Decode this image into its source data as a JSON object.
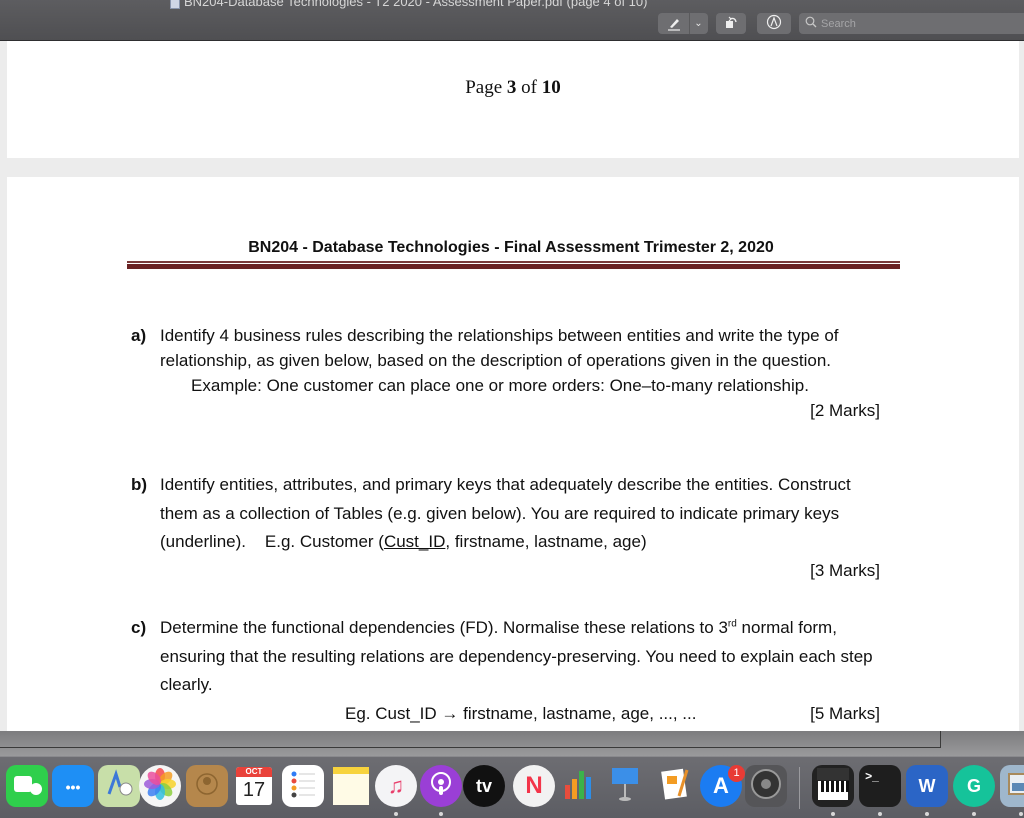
{
  "window": {
    "title": "BN204-Database Technologies - T2 2020 - Assessment Paper.pdf (page 4 of 10)"
  },
  "toolbar": {
    "markup_icon": "pen-icon",
    "markup_menu_icon": "chevron-down-icon",
    "rotate_icon": "rotate-icon",
    "annotate_icon": "markup-icon",
    "search_placeholder": "Search",
    "search_value": ""
  },
  "pages": {
    "previous_footer": {
      "prefix": "Page ",
      "current": "3",
      "middle": " of ",
      "total": "10"
    },
    "current": {
      "header": "BN204 - Database Technologies - Final Assessment Trimester 2, 2020",
      "questions": [
        {
          "label": "a)",
          "text": "Identify 4 business rules describing the relationships between entities and write the type of relationship, as given below, based on the description of operations given in the question.",
          "example": "Example:  One customer can place one or more orders: One–to-many relationship.",
          "marks": "[2 Marks]"
        },
        {
          "label": "b)",
          "text": "Identify entities, attributes, and primary keys that adequately describe the entities. Construct them as a collection of Tables (e.g. given below). You are required to indicate primary keys (underline).",
          "example_prefix": "E.g. Customer (",
          "example_key": "Cust_ID",
          "example_suffix": ", firstname, lastname, age)",
          "marks": "[3 Marks]"
        },
        {
          "label": "c)",
          "text_before_sup": "Determine the functional dependencies (FD). Normalise these relations to 3",
          "sup": "rd",
          "text_after_sup": " normal form, ensuring that the resulting relations are dependency-preserving. You need to explain each step clearly.",
          "example_prefix": "Eg.  Cust_ID  ",
          "example_arrow": "→",
          "example_suffix": " firstname, lastname, age, ..., ...",
          "marks": "[5 Marks]"
        }
      ]
    }
  },
  "dock": {
    "items": [
      {
        "name": "FaceTime",
        "icon": "facetime-icon",
        "color": "#2fcf4c",
        "running": false
      },
      {
        "name": "Messages",
        "icon": "messages-icon",
        "color": "#1e8ff5",
        "running": false
      },
      {
        "name": "Maps",
        "icon": "maps-icon",
        "color": "#c8dfa9",
        "running": false
      },
      {
        "name": "Photos",
        "icon": "photos-icon",
        "color": "#f5f5f5",
        "running": false
      },
      {
        "name": "Contacts",
        "icon": "contacts-icon",
        "color": "#b5874c",
        "running": false
      },
      {
        "name": "Calendar",
        "icon": "calendar-icon",
        "color": "#ffffff",
        "month": "OCT",
        "day": "17",
        "running": false
      },
      {
        "name": "Reminders",
        "icon": "reminders-icon",
        "color": "#ffffff",
        "running": false
      },
      {
        "name": "Notes",
        "icon": "notes-icon",
        "color": "#fff8d6",
        "running": false
      },
      {
        "name": "Music",
        "icon": "music-icon",
        "color": "#f4f4f6",
        "running": true
      },
      {
        "name": "Podcasts",
        "icon": "podcasts-icon",
        "color": "#9a3fd6",
        "running": true
      },
      {
        "name": "TV",
        "icon": "apple-tv-icon",
        "color": "#111111",
        "label": "tv",
        "running": false
      },
      {
        "name": "News",
        "icon": "news-icon",
        "color": "#f2f2f2",
        "running": false
      },
      {
        "name": "Numbers",
        "icon": "numbers-icon",
        "color": "#6a6b70",
        "running": false
      },
      {
        "name": "Keynote",
        "icon": "keynote-icon",
        "color": "#3b8fe8",
        "running": false
      },
      {
        "name": "Pages",
        "icon": "pages-icon",
        "color": "#f5a14a",
        "running": false
      },
      {
        "name": "App Store",
        "icon": "app-store-icon",
        "color": "#1b7cf2",
        "badge": "1",
        "running": false
      },
      {
        "name": "System Preferences",
        "icon": "system-preferences-icon",
        "color": "#555558",
        "running": false
      },
      {
        "name": "MIDI Keyboard",
        "icon": "keyboard-instrument-icon",
        "color": "#222222",
        "running": true
      },
      {
        "name": "Terminal",
        "icon": "terminal-icon",
        "color": "#1e1e1e",
        "label": ">_",
        "running": true
      },
      {
        "name": "Microsoft Word",
        "icon": "word-icon",
        "color": "#2b65c6",
        "label": "W",
        "running": true
      },
      {
        "name": "Grammarly",
        "icon": "grammarly-icon",
        "color": "#15c39a",
        "label": "G",
        "running": true
      },
      {
        "name": "Preview",
        "icon": "preview-icon",
        "color": "#9fb7cc",
        "running": true
      }
    ]
  }
}
